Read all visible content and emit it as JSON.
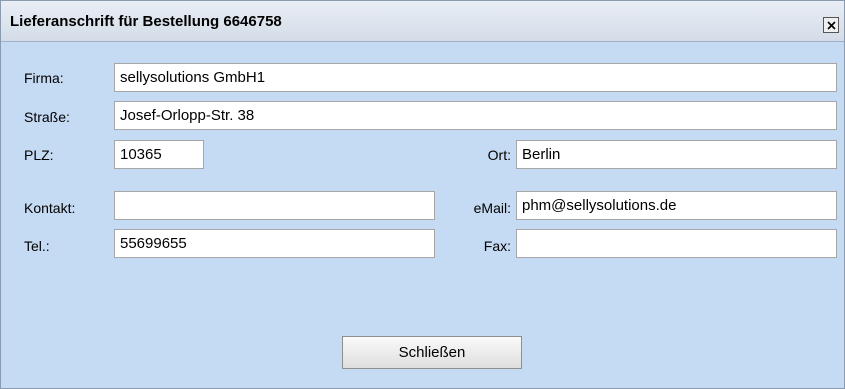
{
  "dialog": {
    "title": "Lieferanschrift für Bestellung 6646758",
    "close_icon": "close-icon"
  },
  "form": {
    "firma": {
      "label": "Firma:",
      "value": "sellysolutions GmbH1"
    },
    "strasse": {
      "label": "Straße:",
      "value": "Josef-Orlopp-Str. 38"
    },
    "plz": {
      "label": "PLZ:",
      "value": "10365"
    },
    "ort": {
      "label": "Ort:",
      "value": "Berlin"
    },
    "kontakt": {
      "label": "Kontakt:",
      "value": ""
    },
    "email": {
      "label": "eMail:",
      "value": "phm@sellysolutions.de"
    },
    "tel": {
      "label": "Tel.:",
      "value": "55699655"
    },
    "fax": {
      "label": "Fax:",
      "value": ""
    }
  },
  "buttons": {
    "close_label": "Schließen"
  },
  "colors": {
    "dialog_background": "#c5daf3",
    "titlebar": "#dbe3ed"
  }
}
